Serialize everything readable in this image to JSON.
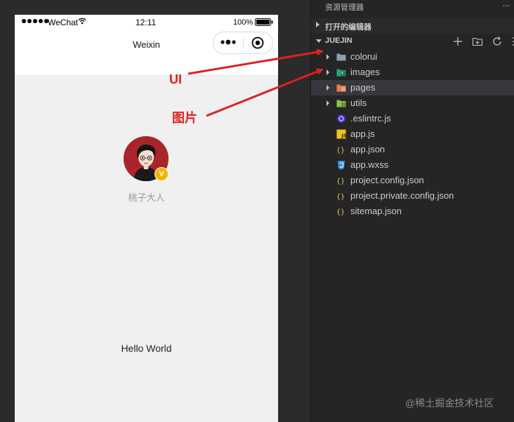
{
  "phone": {
    "status_bar": {
      "carrier": "WeChat",
      "time": "12:11",
      "battery": "100%"
    },
    "nav_title": "Weixin",
    "user": {
      "nickname": "桃子大人",
      "badge": "V"
    },
    "hello_text": "Hello World"
  },
  "explorer": {
    "title": "资源管理器",
    "open_editors_label": "打开的编辑器",
    "project_label": "JUEJIN",
    "items": [
      {
        "label": "colorui",
        "type": "folder",
        "icon": "folder-icon",
        "color": "#8aa0ac"
      },
      {
        "label": "images",
        "type": "folder",
        "icon": "images-folder-icon",
        "color": "#2aa37a"
      },
      {
        "label": "pages",
        "type": "folder",
        "icon": "pages-folder-icon",
        "color": "#e07b53",
        "selected": true
      },
      {
        "label": "utils",
        "type": "folder",
        "icon": "utils-folder-icon",
        "color": "#8bc34a"
      },
      {
        "label": ".eslintrc.js",
        "type": "file",
        "icon": "eslint-icon",
        "color": "#4b32c3"
      },
      {
        "label": "app.js",
        "type": "file",
        "icon": "js-file-icon",
        "color": "#f0c419"
      },
      {
        "label": "app.json",
        "type": "file",
        "icon": "json-file-icon",
        "color": "#e8c35a"
      },
      {
        "label": "app.wxss",
        "type": "file",
        "icon": "css-file-icon",
        "color": "#3d8fd9"
      },
      {
        "label": "project.config.json",
        "type": "file",
        "icon": "json-file-icon",
        "color": "#e8c35a"
      },
      {
        "label": "project.private.config.json",
        "type": "file",
        "icon": "json-file-icon",
        "color": "#e8c35a"
      },
      {
        "label": "sitemap.json",
        "type": "file",
        "icon": "json-file-icon",
        "color": "#e8c35a"
      }
    ]
  },
  "annotations": {
    "ui_label": "UI",
    "images_label": "图片",
    "arrow_color": "#e02020"
  },
  "watermark": "@稀土掘金技术社区"
}
